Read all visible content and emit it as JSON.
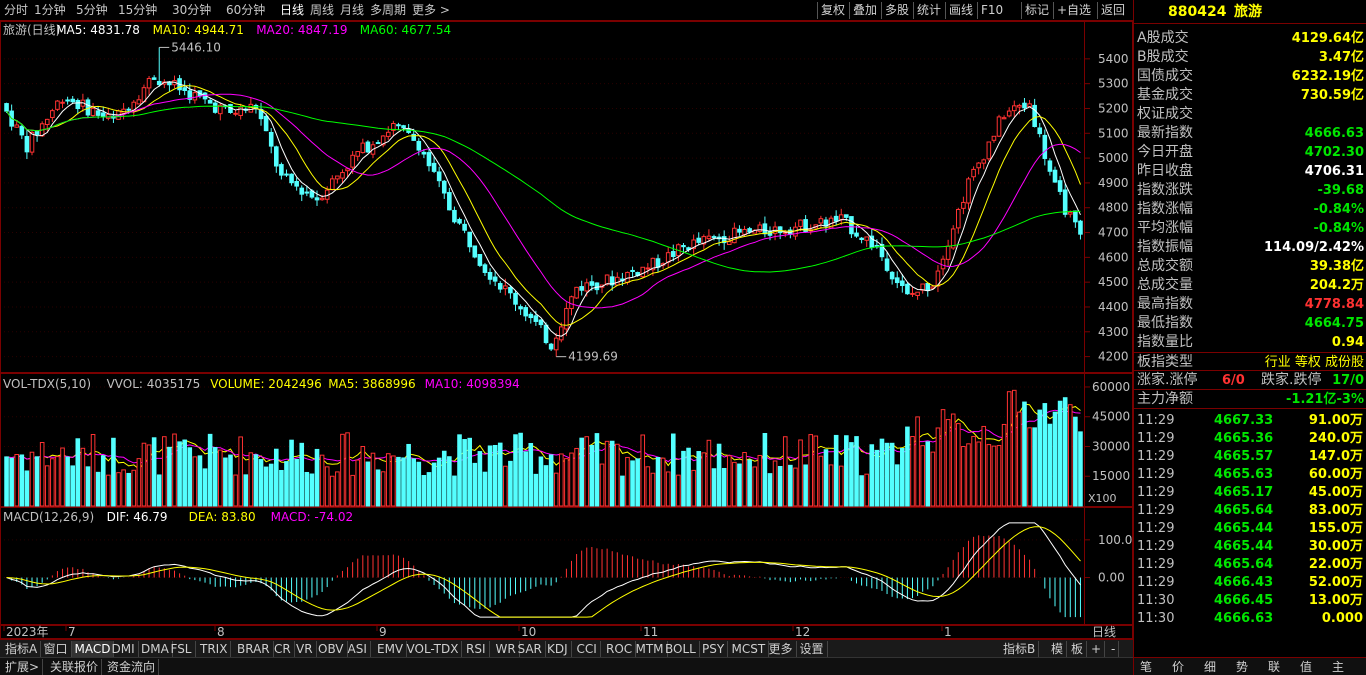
{
  "topbar": {
    "periods": [
      "分时",
      "1分钟",
      "5分钟",
      "15分钟",
      "30分钟",
      "60分钟",
      "日线",
      "周线",
      "月线",
      "多周期",
      "更多 >"
    ],
    "active_period": "日线",
    "right_buttons": [
      "复权",
      "叠加",
      "多股",
      "统计",
      "画线",
      "F10",
      "标记",
      "+自选",
      "返回"
    ]
  },
  "main_panel": {
    "name": "旅游(日线)",
    "ma5": "MA5: 4831.78",
    "ma10": "MA10: 4944.71",
    "ma20": "MA20: 4847.19",
    "ma60": "MA60: 4677.54",
    "high_mark": "5446.10",
    "low_mark": "4199.69",
    "y_ticks": [
      "5400",
      "5300",
      "5200",
      "5100",
      "5000",
      "4900",
      "4800",
      "4700",
      "4600",
      "4500",
      "4400",
      "4300",
      "4200"
    ]
  },
  "vol_panel": {
    "title": "VOL-TDX(5,10)",
    "vvol": "VVOL: 4035175",
    "volume": "VOLUME: 2042496",
    "ma5": "MA5: 3868996",
    "ma10": "MA10: 4098394",
    "y_ticks": [
      "60000",
      "45000",
      "30000",
      "15000"
    ],
    "unit": "X100"
  },
  "macd_panel": {
    "title": "MACD(12,26,9)",
    "dif": "DIF: 46.79",
    "dea": "DEA: 83.80",
    "macd": "MACD: -74.02",
    "y_ticks": [
      "100.0",
      "0.00"
    ]
  },
  "x_axis": {
    "labels": [
      "2023年",
      "7",
      "8",
      "9",
      "10",
      "11",
      "12",
      "1"
    ],
    "right_label": "日线"
  },
  "chart_data": {
    "type": "candlestick",
    "title": "旅游(日线)",
    "ylim": [
      4150,
      5480
    ],
    "high": 5446.1,
    "low": 4199.69,
    "overlays": {
      "MA5": 4831.78,
      "MA10": 4944.71,
      "MA20": 4847.19,
      "MA60": 4677.54
    },
    "volume_ylim": [
      0,
      62000
    ],
    "macd_ylim": [
      -110,
      150
    ],
    "latest": {
      "DIF": 46.79,
      "DEA": 83.8,
      "MACD": -74.02
    }
  },
  "colors": {
    "up": "#ff3232",
    "down": "#54ffff",
    "ma5": "#ffffff",
    "ma10": "#ffff00",
    "ma20": "#ff00ff",
    "ma60": "#00ff00",
    "border": "#7a0000"
  },
  "bottom_tabs": {
    "items": [
      "指标A",
      "窗口",
      "MACD",
      "DMI",
      "DMA",
      "FSL",
      "TRIX",
      "BRAR",
      "CR",
      "VR",
      "OBV",
      "ASI",
      "EMV",
      "VOL-TDX",
      "RSI",
      "WR",
      "SAR",
      "KDJ",
      "CCI",
      "ROC",
      "MTM",
      "BOLL",
      "PSY",
      "MCST",
      "更多",
      "设置"
    ],
    "active": "MACD",
    "right_items": [
      "指标B",
      "模",
      "板",
      "+",
      "-"
    ]
  },
  "bottom2": {
    "items": [
      "扩展>",
      "关联报价",
      "资金流向"
    ]
  },
  "right_panel": {
    "code": "880424",
    "name": "旅游",
    "rows": [
      {
        "label": "A股成交",
        "value": "4129.64亿",
        "color": "#ffff00"
      },
      {
        "label": "B股成交",
        "value": "3.47亿",
        "color": "#ffff00"
      },
      {
        "label": "国债成交",
        "value": "6232.19亿",
        "color": "#ffff00"
      },
      {
        "label": "基金成交",
        "value": "730.59亿",
        "color": "#ffff00"
      },
      {
        "label": "权证成交",
        "value": "",
        "color": "#ffff00"
      },
      {
        "label": "最新指数",
        "value": "4666.63",
        "color": "#00e600"
      },
      {
        "label": "今日开盘",
        "value": "4702.30",
        "color": "#00e600"
      },
      {
        "label": "昨日收盘",
        "value": "4706.31",
        "color": "#ffffff"
      },
      {
        "label": "指数涨跌",
        "value": "-39.68",
        "color": "#00e600"
      },
      {
        "label": "指数涨幅",
        "value": "-0.84%",
        "color": "#00e600"
      },
      {
        "label": "平均涨幅",
        "value": "-0.84%",
        "color": "#00e600"
      },
      {
        "label": "指数振幅",
        "value": "114.09/2.42%",
        "color": "#ffffff"
      },
      {
        "label": "总成交额",
        "value": "39.38亿",
        "color": "#ffff00"
      },
      {
        "label": "总成交量",
        "value": "204.2万",
        "color": "#ffff00"
      },
      {
        "label": "最高指数",
        "value": "4778.84",
        "color": "#ff3232"
      },
      {
        "label": "最低指数",
        "value": "4664.75",
        "color": "#00e600"
      },
      {
        "label": "指数量比",
        "value": "0.94",
        "color": "#ffff00"
      }
    ],
    "board_type_label": "板指类型",
    "board_type_value": "行业 等权 成份股",
    "up_label": "涨家.涨停",
    "up_value": "6/0",
    "down_label": "跌家.跌停",
    "down_value": "17/0",
    "main_label": "主力净额",
    "main_value": "-1.21亿",
    "main_pct": "-3%",
    "ticks": [
      {
        "t": "11:29",
        "p": "4667.33",
        "v": "91.00万"
      },
      {
        "t": "11:29",
        "p": "4665.36",
        "v": "240.0万"
      },
      {
        "t": "11:29",
        "p": "4665.57",
        "v": "147.0万"
      },
      {
        "t": "11:29",
        "p": "4665.63",
        "v": "60.00万"
      },
      {
        "t": "11:29",
        "p": "4665.17",
        "v": "45.00万"
      },
      {
        "t": "11:29",
        "p": "4665.64",
        "v": "83.00万"
      },
      {
        "t": "11:29",
        "p": "4665.44",
        "v": "155.0万"
      },
      {
        "t": "11:29",
        "p": "4665.44",
        "v": "30.00万"
      },
      {
        "t": "11:29",
        "p": "4665.64",
        "v": "22.00万"
      },
      {
        "t": "11:29",
        "p": "4666.43",
        "v": "52.00万"
      },
      {
        "t": "11:30",
        "p": "4666.45",
        "v": "13.00万"
      },
      {
        "t": "11:30",
        "p": "4666.63",
        "v": "0.000"
      }
    ],
    "tabs": [
      "笔",
      "价",
      "细",
      "势",
      "联",
      "值",
      "主"
    ]
  }
}
